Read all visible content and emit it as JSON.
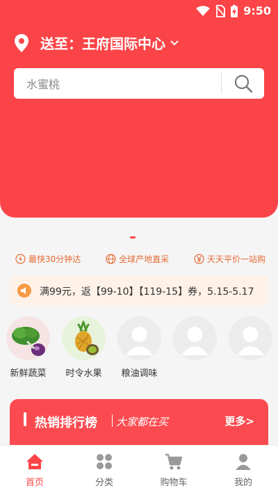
{
  "status_bar": {
    "time": "9:50"
  },
  "header": {
    "deliver_to_prefix": "送至：",
    "location_name": "王府国际中心"
  },
  "search": {
    "placeholder": "水蜜桃"
  },
  "features": [
    {
      "label": "最快30分钟达",
      "icon": "lightning-icon"
    },
    {
      "label": "全球产地直采",
      "icon": "globe-icon"
    },
    {
      "label": "天天平价一站购",
      "icon": "yen-icon"
    }
  ],
  "notice": {
    "text": "满99元，返【99-10】【119-15】券，5.15-5.17"
  },
  "categories": [
    {
      "label": "新鲜蔬菜"
    },
    {
      "label": "时令水果"
    },
    {
      "label": "粮油调味"
    },
    {
      "label": ""
    },
    {
      "label": ""
    }
  ],
  "hot_section": {
    "title": "热销排行榜",
    "subtitle": "大家都在买",
    "more": "更多>"
  },
  "tabbar": [
    {
      "label": "首页",
      "icon": "home-icon"
    },
    {
      "label": "分类",
      "icon": "category-icon"
    },
    {
      "label": "购物车",
      "icon": "cart-icon"
    },
    {
      "label": "我的",
      "icon": "user-icon"
    }
  ],
  "colors": {
    "primary": "#fb4448",
    "accent": "#e56b35"
  }
}
